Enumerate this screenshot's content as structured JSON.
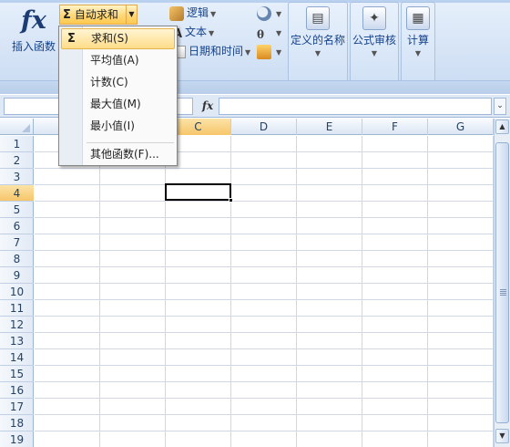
{
  "ribbon": {
    "insert_function": {
      "icon": "fx",
      "label": "插入函数"
    },
    "autosum": {
      "label": "自动求和",
      "sigma": "Σ"
    },
    "logic": {
      "label": "逻辑"
    },
    "text": {
      "label": "文本"
    },
    "datetime": {
      "label": "日期和时间"
    },
    "defined_names": {
      "label": "定义的名称"
    },
    "formula_audit": {
      "label": "公式审核"
    },
    "calculation": {
      "label": "计算"
    }
  },
  "formula_bar": {
    "fx_label": "fx",
    "name_value": "",
    "formula_value": ""
  },
  "menu": {
    "items": [
      {
        "label": "求和(S)",
        "selected": true,
        "icon": "Σ"
      },
      {
        "label": "平均值(A)"
      },
      {
        "label": "计数(C)"
      },
      {
        "label": "最大值(M)"
      },
      {
        "label": "最小值(I)"
      },
      {
        "label": "其他函数(F)..."
      }
    ]
  },
  "grid": {
    "columns": [
      "C",
      "D",
      "E",
      "F",
      "G"
    ],
    "active_column": "C",
    "rows": [
      "1",
      "2",
      "3",
      "4",
      "5",
      "6",
      "7",
      "8",
      "9",
      "10",
      "11",
      "12",
      "13",
      "14",
      "15",
      "16",
      "17",
      "18",
      "19"
    ],
    "active_row": "4"
  },
  "colors": {
    "highlight": "#ffd778",
    "ribbon": "#d9e6f7",
    "grid_line": "#d0d7e5"
  }
}
